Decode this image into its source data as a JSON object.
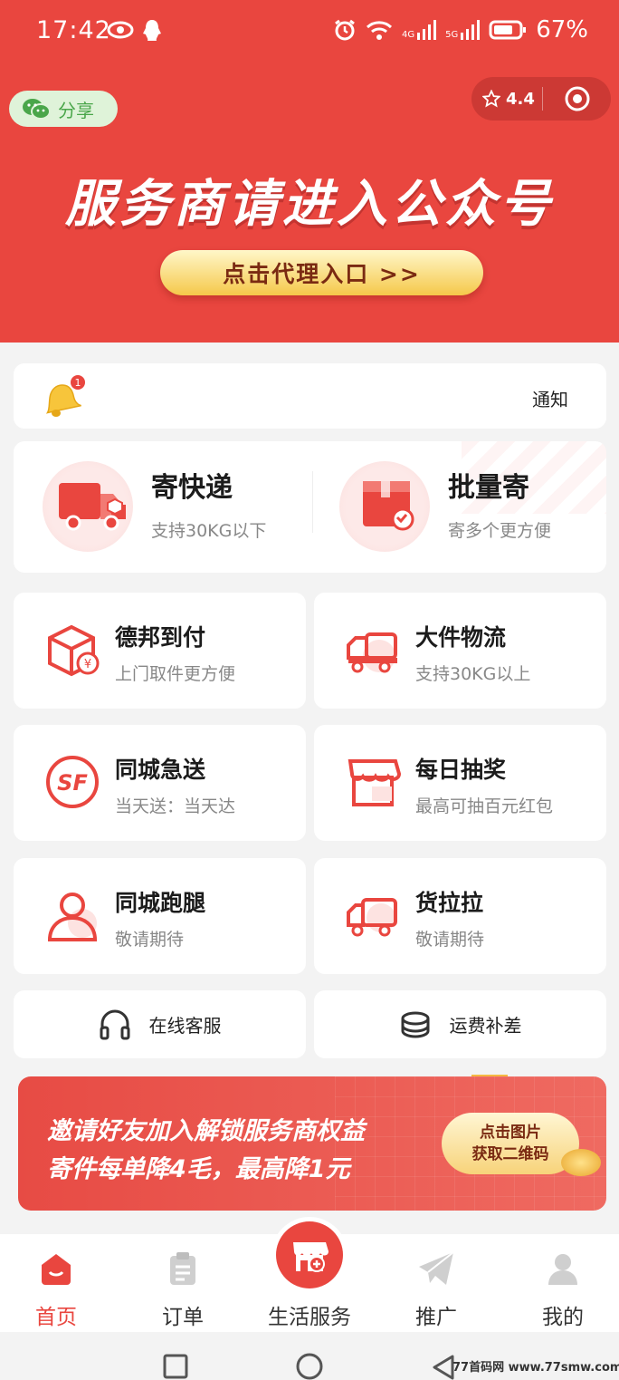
{
  "status_bar": {
    "time": "17:42",
    "battery": "67%",
    "net_4g": "4G",
    "net_5g": "5G"
  },
  "header": {
    "share_label": "分享",
    "rating": "4.4"
  },
  "banner": {
    "title": "服务商请进入公众号",
    "button": "点击代理入口 >>"
  },
  "notice": {
    "label": "通知",
    "badge": "1"
  },
  "shipping": [
    {
      "title": "寄快递",
      "subtitle": "支持30KG以下"
    },
    {
      "title": "批量寄",
      "subtitle": "寄多个更方便"
    }
  ],
  "services": [
    {
      "title": "德邦到付",
      "subtitle": "上门取件更方便",
      "icon": "box-yen-icon"
    },
    {
      "title": "大件物流",
      "subtitle": "支持30KG以上",
      "icon": "big-truck-icon"
    },
    {
      "title": "同城急送",
      "subtitle": "当天送：当天达",
      "icon": "sf-logo-icon"
    },
    {
      "title": "每日抽奖",
      "subtitle": "最高可抽百元红包",
      "icon": "shop-icon"
    },
    {
      "title": "同城跑腿",
      "subtitle": "敬请期待",
      "icon": "person-icon"
    },
    {
      "title": "货拉拉",
      "subtitle": "敬请期待",
      "icon": "van-icon"
    }
  ],
  "support": [
    {
      "label": "在线客服",
      "icon": "headset-icon"
    },
    {
      "label": "运费补差",
      "icon": "coins-icon"
    }
  ],
  "invite": {
    "line1": "邀请好友加入解锁服务商权益",
    "line2": "寄件每单降4毛，最高降1元",
    "button_line1": "点击图片",
    "button_line2": "获取二维码"
  },
  "tabs": [
    {
      "label": "首页",
      "active": true
    },
    {
      "label": "订单",
      "active": false
    },
    {
      "label": "生活服务",
      "active": false
    },
    {
      "label": "推广",
      "active": false
    },
    {
      "label": "我的",
      "active": false
    }
  ],
  "watermark": "77首码网 www.77smw.com",
  "colors": {
    "brand": "#e9463f",
    "gold": "#f5c84a",
    "wechat": "#4aa64a"
  }
}
